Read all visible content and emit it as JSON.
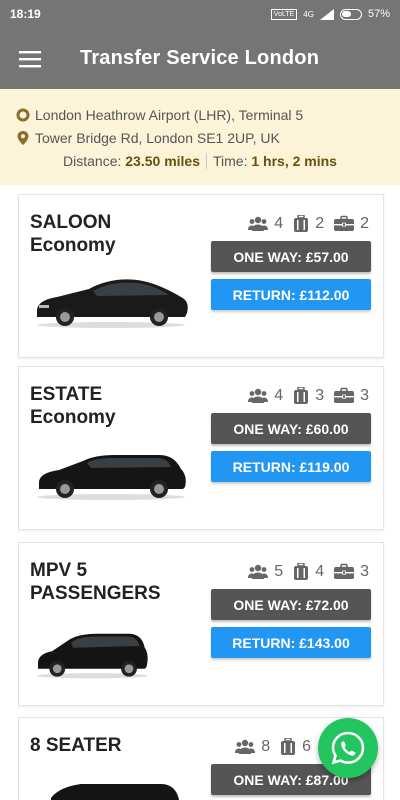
{
  "status_bar": {
    "time": "18:19",
    "network": "4G",
    "battery": "57%"
  },
  "app_bar": {
    "title": "Transfer Service London",
    "menu_icon": "hamburger-menu-icon"
  },
  "route": {
    "pickup": "London Heathrow Airport (LHR), Terminal 5",
    "dropoff": "Tower Bridge Rd, London SE1 2UP, UK",
    "distance_label": "Distance:",
    "distance_value": "23.50 miles",
    "time_label": "Time:",
    "time_value": "1 hrs, 2 mins"
  },
  "vehicles": [
    {
      "name_line1": "SALOON",
      "name_line2": "Economy",
      "passengers": "4",
      "luggage": "2",
      "hand_luggage": "2",
      "one_way": "ONE WAY: £57.00",
      "return": "RETURN: £112.00"
    },
    {
      "name_line1": "ESTATE",
      "name_line2": "Economy",
      "passengers": "4",
      "luggage": "3",
      "hand_luggage": "3",
      "one_way": "ONE WAY: £60.00",
      "return": "RETURN: £119.00"
    },
    {
      "name_line1": "MPV 5",
      "name_line2": "PASSENGERS",
      "passengers": "5",
      "luggage": "4",
      "hand_luggage": "3",
      "one_way": "ONE WAY: £72.00",
      "return": "RETURN: £143.00"
    },
    {
      "name_line1": "8 SEATER",
      "name_line2": "",
      "passengers": "8",
      "luggage": "6",
      "hand_luggage": "",
      "one_way": "ONE WAY: £87.00",
      "return": ""
    }
  ],
  "colors": {
    "header": "#757575",
    "route_bg": "#fcf4d8",
    "one_way_btn": "#555555",
    "return_btn": "#2196f3",
    "whatsapp": "#22c55e"
  }
}
